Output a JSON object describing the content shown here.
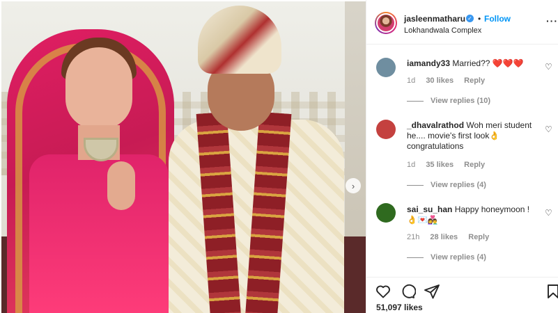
{
  "post": {
    "username": "jasleenmatharu",
    "follow_label": "Follow",
    "dot": "•",
    "location": "Lokhandwala Complex",
    "more": "···"
  },
  "comments": [
    {
      "username": "iamandy33",
      "text": "Married?? ❤️❤️❤️",
      "age": "1d",
      "likes": "30 likes",
      "reply": "Reply",
      "view_replies": "View replies (10)",
      "avatar_color": "#6f8ea0"
    },
    {
      "username": "_dhavalrathod",
      "text": "Woh meri student he.... movie's first look👌 congratulations",
      "age": "1d",
      "likes": "35 likes",
      "reply": "Reply",
      "view_replies": "View replies (4)",
      "avatar_color": "#c4413f"
    },
    {
      "username": "sai_su_han",
      "text": "Happy honeymoon ! 👌💌👩‍❤️‍👨",
      "age": "21h",
      "likes": "28 likes",
      "reply": "Reply",
      "view_replies": "View replies (4)",
      "avatar_color": "#2f6a1f"
    }
  ],
  "actions": {
    "like_icon": "heart-icon",
    "comment_icon": "comment-bubble-icon",
    "share_icon": "paper-plane-icon",
    "save_icon": "bookmark-icon",
    "likes_count": "51,097 likes"
  },
  "carousel": {
    "next_icon": "›"
  },
  "colors": {
    "link_blue": "#0095f6",
    "verified_blue": "#3897f0",
    "meta_gray": "#8e8e8e"
  }
}
